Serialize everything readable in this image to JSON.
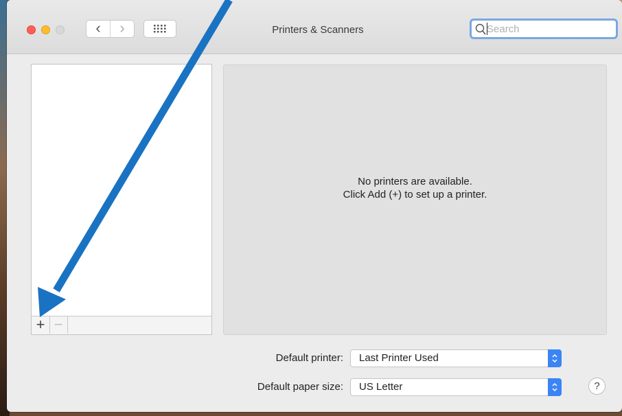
{
  "window": {
    "title": "Printers & Scanners"
  },
  "toolbar": {
    "back_glyph": "‹",
    "forward_glyph": "›",
    "show_all_icon": "grid-icon"
  },
  "search": {
    "placeholder": "Search",
    "value": ""
  },
  "printer_list": {
    "items": [],
    "add_label": "+",
    "remove_label": "−"
  },
  "detail": {
    "empty_line1": "No printers are available.",
    "empty_line2": "Click Add (+) to set up a printer."
  },
  "settings": {
    "default_printer_label": "Default printer:",
    "default_printer_value": "Last Printer Used",
    "paper_size_label": "Default paper size:",
    "paper_size_value": "US Letter"
  },
  "help_label": "?",
  "colors": {
    "accent": "#3b84f5",
    "annotation_arrow": "#1a73c2",
    "traffic_red": "#ff5f57",
    "traffic_yellow": "#febc2e"
  }
}
